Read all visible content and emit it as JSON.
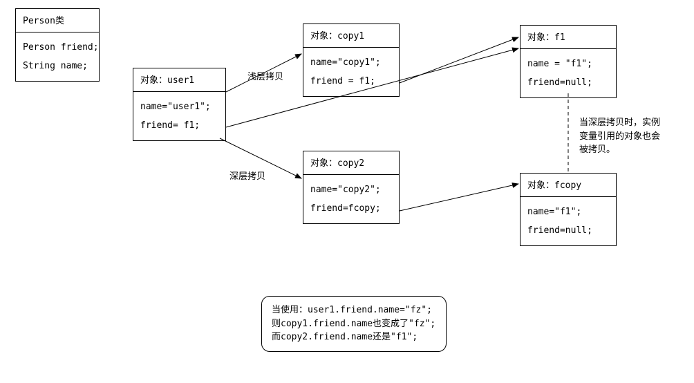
{
  "personClass": {
    "title": "Person类",
    "field1": "Person friend;",
    "field2": "String name;"
  },
  "user1": {
    "title": "对象：user1",
    "name": "name=\"user1\";",
    "friend": "friend= f1;"
  },
  "copy1": {
    "title": "对象：copy1",
    "name": "name=\"copy1\";",
    "friend": "friend = f1;"
  },
  "copy2": {
    "title": "对象：copy2",
    "name": "name=\"copy2\";",
    "friend": "friend=fcopy;"
  },
  "f1": {
    "title": "对象：f1",
    "name": "name = \"f1\";",
    "friend": "friend=null;"
  },
  "fcopy": {
    "title": "对象：fcopy",
    "name": "name=\"f1\";",
    "friend": "friend=null;"
  },
  "labels": {
    "shallow": "浅层拷贝",
    "deep": "深层拷贝"
  },
  "sideNote": {
    "l1": "当深层拷贝时，实例",
    "l2": "变量引用的对象也会",
    "l3": "被拷贝。"
  },
  "note": {
    "l1": "当使用：user1.friend.name=\"fz\";",
    "l2": "则copy1.friend.name也变成了\"fz\";",
    "l3": "而copy2.friend.name还是\"f1\";"
  }
}
